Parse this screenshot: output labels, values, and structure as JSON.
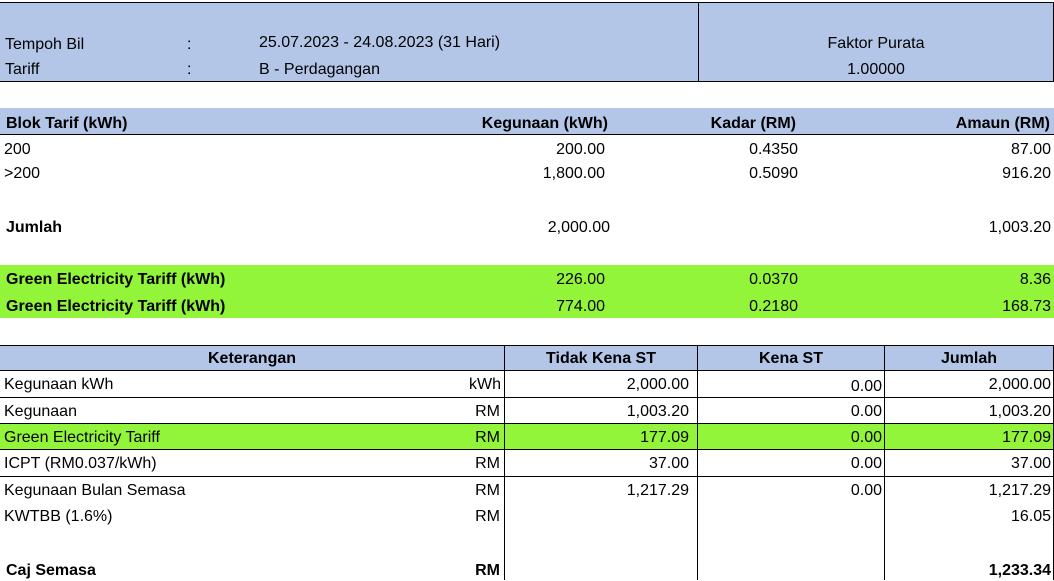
{
  "header": {
    "tempoh_label": "Tempoh Bil",
    "tempoh_colon": ":",
    "tempoh_value": "25.07.2023 - 24.08.2023 (31 Hari)",
    "tariff_label": "Tariff",
    "tariff_colon": ":",
    "tariff_value": "B - Perdagangan",
    "faktor_label": "Faktor Purata",
    "faktor_value": "1.00000"
  },
  "blok": {
    "headers": [
      "Blok Tarif (kWh)",
      "Kegunaan (kWh)",
      "Kadar (RM)",
      "Amaun (RM)"
    ],
    "rows": [
      {
        "blok": "200",
        "kegunaan": "200.00",
        "kadar": "0.4350",
        "amaun": "87.00"
      },
      {
        "blok": ">200",
        "kegunaan": "1,800.00",
        "kadar": "0.5090",
        "amaun": "916.20"
      }
    ],
    "jumlah": {
      "label": "Jumlah",
      "kegunaan": "2,000.00",
      "amaun": "1,003.20"
    },
    "green_rows": [
      {
        "label": "Green Electricity Tariff (kWh)",
        "kegunaan": "226.00",
        "kadar": "0.0370",
        "amaun": "8.36"
      },
      {
        "label": "Green Electricity Tariff (kWh)",
        "kegunaan": "774.00",
        "kadar": "0.2180",
        "amaun": "168.73"
      }
    ]
  },
  "summary": {
    "headers": [
      "Keterangan",
      "Tidak Kena ST",
      "Kena ST",
      "Jumlah"
    ],
    "rows": [
      {
        "label": "Kegunaan kWh",
        "unit": "kWh",
        "tidak": "2,000.00",
        "kena": "0.00",
        "jumlah": "2,000.00"
      },
      {
        "label": "Kegunaan",
        "unit": "RM",
        "tidak": "1,003.20",
        "kena": "0.00",
        "jumlah": "1,003.20"
      },
      {
        "label": "Green Electricity Tariff",
        "unit": "RM",
        "tidak": "177.09",
        "kena": "0.00",
        "jumlah": "177.09"
      },
      {
        "label": "ICPT (RM0.037/kWh)",
        "unit": "RM",
        "tidak": "37.00",
        "kena": "0.00",
        "jumlah": "37.00"
      },
      {
        "label": "Kegunaan Bulan Semasa",
        "unit": "RM",
        "tidak": "1,217.29",
        "kena": "0.00",
        "jumlah": "1,217.29"
      },
      {
        "label": "KWTBB (1.6%)",
        "unit": "RM",
        "tidak": "",
        "kena": "",
        "jumlah": "16.05"
      }
    ],
    "caj": {
      "label": "Caj Semasa",
      "unit": "RM",
      "jumlah": "1,233.34"
    }
  }
}
